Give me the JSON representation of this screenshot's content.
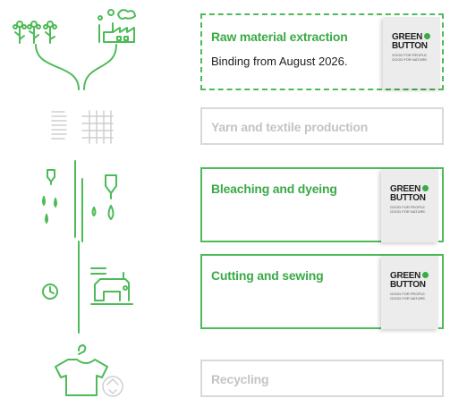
{
  "stages": [
    {
      "title": "Raw material extraction",
      "subtitle": "Binding from August 2026.",
      "state": "dashed-green"
    },
    {
      "title": "Yarn and textile production",
      "state": "inactive"
    },
    {
      "title": "Bleaching and dyeing",
      "state": "active"
    },
    {
      "title": "Cutting and sewing",
      "state": "active"
    },
    {
      "title": "Recycling",
      "state": "inactive"
    }
  ],
  "label": {
    "line1": "GREEN",
    "line2": "BUTTON",
    "slogan1": "GOOD FOR PEOPLE.",
    "slogan2": "GOOD FOR NATURE."
  },
  "colors": {
    "accent": "#4dbb57",
    "inactive": "#d9d9d9",
    "text_accent": "#3aaa46"
  },
  "icons": [
    "flowers-icon",
    "factory-icon",
    "yarn-spool-icon",
    "woven-fabric-icon",
    "dye-dropper-icon",
    "clock-icon",
    "sewing-machine-icon",
    "shirt-hanger-icon",
    "recycle-icon"
  ]
}
